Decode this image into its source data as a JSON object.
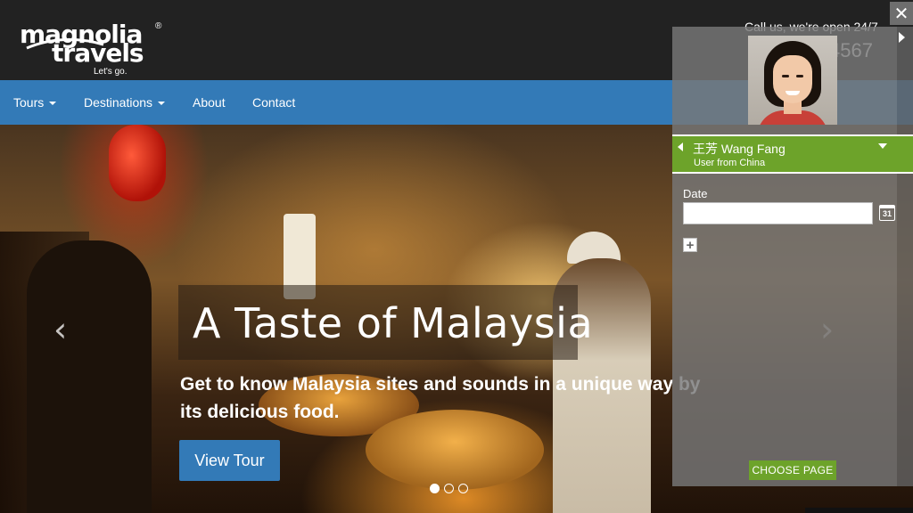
{
  "header": {
    "logo_line1": "magnolia",
    "logo_line2": "travels",
    "logo_reg": "®",
    "tagline": "Let's go.",
    "call_text": "Call us, we're open 24/7",
    "phone_partial": "4567"
  },
  "nav": {
    "items": [
      {
        "label": "Tours",
        "dropdown": true
      },
      {
        "label": "Destinations",
        "dropdown": true
      },
      {
        "label": "About",
        "dropdown": false
      },
      {
        "label": "Contact",
        "dropdown": false
      }
    ]
  },
  "hero": {
    "title": "A Taste of Malaysia",
    "subtitle": "Get to know Malaysia sites and sounds in a unique way by its delicious food.",
    "button_label": "View Tour",
    "prev_glyph": "‹",
    "next_glyph": "›",
    "slides": 3,
    "active_slide": 1
  },
  "panel": {
    "close_glyph": "✕",
    "user_name": "王芳 Wang Fang",
    "user_subtitle": "User from China",
    "date_label": "Date",
    "date_value": "",
    "calendar_day": "31",
    "add_glyph": "+",
    "choose_button": "CHOOSE PAGE"
  },
  "colors": {
    "header_bg": "#222222",
    "nav_bg": "#337ab7",
    "panel_green": "#6da32a",
    "panel_gray": "#787878"
  }
}
